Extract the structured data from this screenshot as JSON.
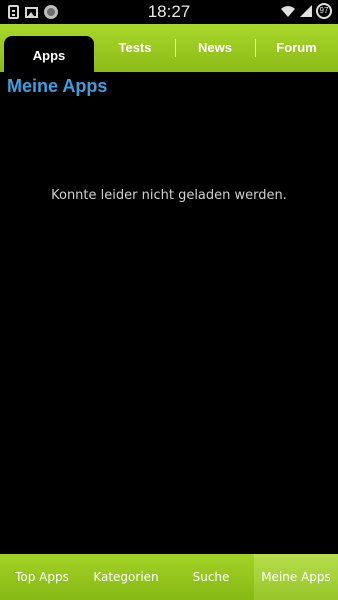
{
  "status_bar": {
    "time": "18:27",
    "battery": "97",
    "icons": [
      "clipboard-icon",
      "gallery-icon",
      "cat-app-icon",
      "wifi-icon",
      "signal-icon",
      "battery-icon"
    ]
  },
  "top_tabs": [
    {
      "label": "Apps",
      "active": true
    },
    {
      "label": "Tests",
      "active": false
    },
    {
      "label": "News",
      "active": false
    },
    {
      "label": "Forum",
      "active": false
    }
  ],
  "page": {
    "title": "Meine Apps",
    "message": "Konnte leider nicht geladen werden."
  },
  "bottom_nav": [
    {
      "label": "Top Apps",
      "active": false
    },
    {
      "label": "Kategorien",
      "active": false
    },
    {
      "label": "Suche",
      "active": false
    },
    {
      "label": "Meine Apps",
      "active": true
    }
  ],
  "colors": {
    "accent_green": "#9acb1f",
    "title_blue": "#3aa0e0",
    "background": "#000000"
  }
}
